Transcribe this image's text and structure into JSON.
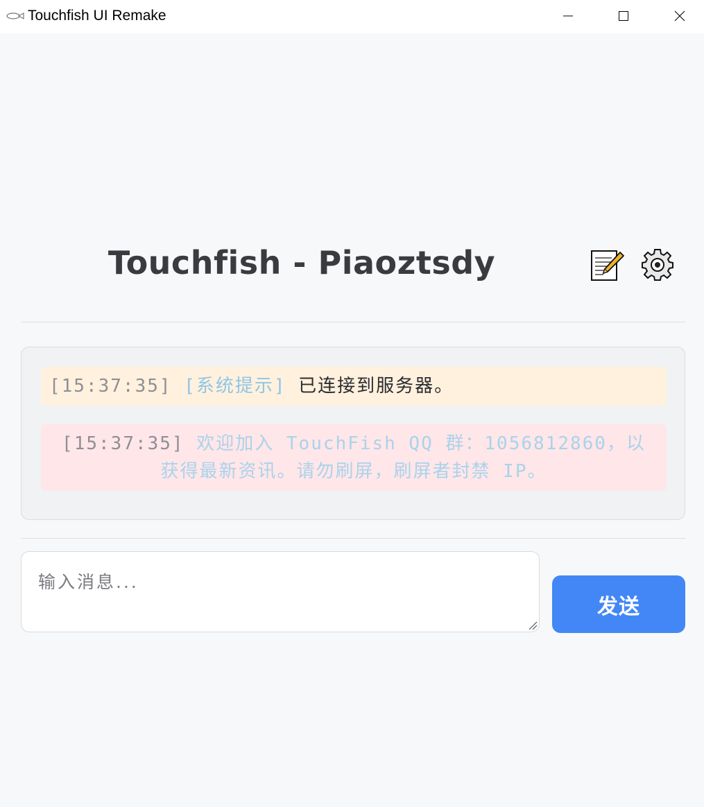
{
  "window": {
    "title": "Touchfish UI Remake",
    "controls": [
      "minimize-icon",
      "maximize-icon",
      "close-icon"
    ]
  },
  "header": {
    "title": "Touchfish - Piaoztsdy",
    "icons": [
      "memo-icon",
      "gear-icon"
    ]
  },
  "messages": [
    {
      "timestamp": "[15:37:35]",
      "tag": "[系统提示]",
      "text": "已连接到服务器。",
      "background": "#fff1de"
    },
    {
      "timestamp": "[15:37:35]",
      "text": "欢迎加入 TouchFish QQ 群：1056812860，以获得最新资讯。请勿刷屏，刷屏者封禁 IP。",
      "background": "#ffe6e9"
    }
  ],
  "composer": {
    "placeholder": "输入消息...",
    "send_label": "发送",
    "accent": "#4287f5"
  }
}
